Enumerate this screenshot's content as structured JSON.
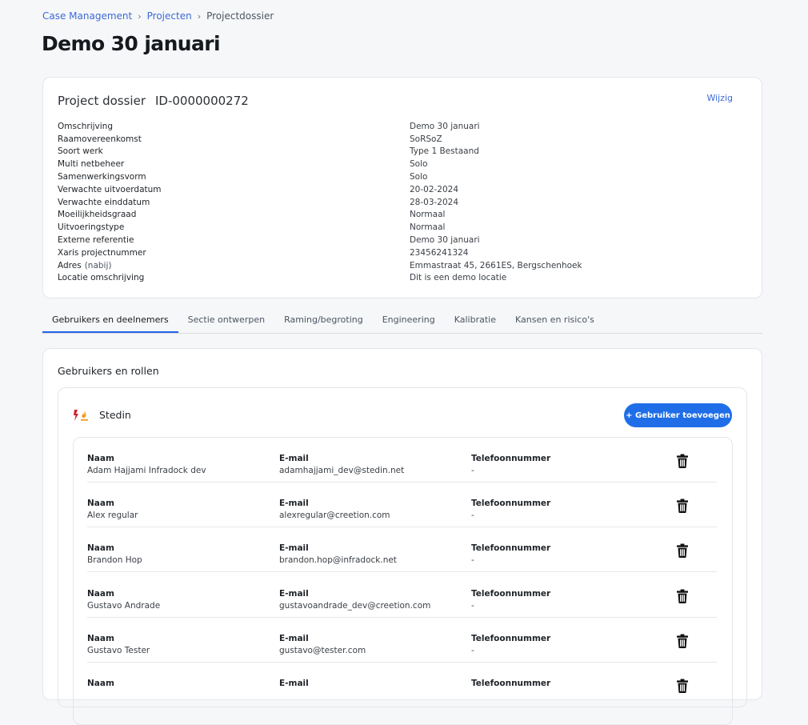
{
  "breadcrumb": {
    "items": [
      {
        "label": "Case Management"
      },
      {
        "label": "Projecten"
      },
      {
        "label": "Projectdossier"
      }
    ],
    "separator": "›"
  },
  "page": {
    "title": "Demo 30 januari"
  },
  "dossier": {
    "title": "Project dossier",
    "id": "ID-0000000272",
    "edit_label": "Wijzig",
    "fields": [
      {
        "label": "Omschrijving",
        "suffix": "",
        "value": "Demo 30 januari"
      },
      {
        "label": "Raamovereenkomst",
        "suffix": "",
        "value": "SoRSoZ"
      },
      {
        "label": "Soort werk",
        "suffix": "",
        "value": "Type 1 Bestaand"
      },
      {
        "label": "Multi netbeheer",
        "suffix": "",
        "value": "Solo"
      },
      {
        "label": "Samenwerkingsvorm",
        "suffix": "",
        "value": "Solo"
      },
      {
        "label": "Verwachte uitvoerdatum",
        "suffix": "",
        "value": "20-02-2024"
      },
      {
        "label": "Verwachte einddatum",
        "suffix": "",
        "value": "28-03-2024"
      },
      {
        "label": "Moeilijkheidsgraad",
        "suffix": "",
        "value": "Normaal"
      },
      {
        "label": "Uitvoeringstype",
        "suffix": "",
        "value": "Normaal"
      },
      {
        "label": "Externe referentie",
        "suffix": "",
        "value": "Demo 30 januari"
      },
      {
        "label": "Xaris projectnummer",
        "suffix": "",
        "value": "23456241324"
      },
      {
        "label": "Adres",
        "suffix": "(nabij)",
        "value": "Emmastraat 45, 2661ES, Bergschenhoek"
      },
      {
        "label": "Locatie omschrijving",
        "suffix": "",
        "value": "Dit is een demo locatie"
      }
    ]
  },
  "tabs": [
    {
      "label": "Gebruikers en deelnemers",
      "active": true
    },
    {
      "label": "Sectie ontwerpen",
      "active": false
    },
    {
      "label": "Raming/begroting",
      "active": false
    },
    {
      "label": "Engineering",
      "active": false
    },
    {
      "label": "Kalibratie",
      "active": false
    },
    {
      "label": "Kansen en risico's",
      "active": false
    }
  ],
  "users_section": {
    "title": "Gebruikers en rollen",
    "organization": {
      "name": "Stedin",
      "logo_icon": "stedin-logo-icon",
      "add_button_label": "+ Gebruiker toevoegen"
    },
    "column_labels": {
      "name": "Naam",
      "email": "E-mail",
      "phone": "Telefoonnummer"
    },
    "users": [
      {
        "name": "Adam Hajjami Infradock dev",
        "email": "adamhajjami_dev@stedin.net",
        "phone": "-"
      },
      {
        "name": "Alex regular",
        "email": "alexregular@creetion.com",
        "phone": "-"
      },
      {
        "name": "Brandon Hop",
        "email": "brandon.hop@infradock.net",
        "phone": "-"
      },
      {
        "name": "Gustavo Andrade",
        "email": "gustavoandrade_dev@creetion.com",
        "phone": "-"
      },
      {
        "name": "Gustavo Tester",
        "email": "gustavo@tester.com",
        "phone": "-"
      },
      {
        "name": "",
        "email": "",
        "phone": ""
      }
    ],
    "delete_icon": "trash-icon"
  },
  "colors": {
    "accent": "#1f6ee8",
    "link": "#3d6ad6",
    "tab_underline": "#2563eb",
    "logo_red": "#d0202f",
    "logo_orange": "#f39200"
  }
}
